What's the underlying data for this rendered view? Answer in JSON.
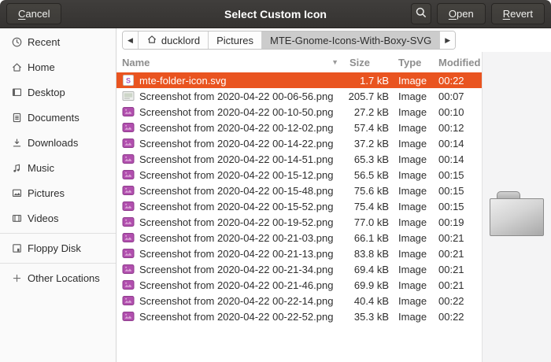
{
  "colors": {
    "accent": "#E95420",
    "headerbar": "#3b3937",
    "sidebar_bg": "#fafafa",
    "preview_bg": "#f4f4f5",
    "thumb_magenta": "#b14fae"
  },
  "header": {
    "title": "Select Custom Icon",
    "cancel_label": "Cancel",
    "open_label": "Open",
    "revert_label": "Revert",
    "search_icon": "search-icon"
  },
  "pathbar": {
    "back_glyph": "◀",
    "forward_glyph": "▶",
    "crumbs": [
      {
        "label": "ducklord",
        "icon": "home-icon",
        "active": false
      },
      {
        "label": "Pictures",
        "active": false
      },
      {
        "label": "MTE-Gnome-Icons-With-Boxy-SVG",
        "active": true
      }
    ]
  },
  "sidebar": {
    "items": [
      {
        "label": "Recent",
        "icon": "clock-icon",
        "separator_before": false
      },
      {
        "label": "Home",
        "icon": "home-icon",
        "separator_before": false
      },
      {
        "label": "Desktop",
        "icon": "desktop-icon",
        "separator_before": false
      },
      {
        "label": "Documents",
        "icon": "document-icon",
        "separator_before": false
      },
      {
        "label": "Downloads",
        "icon": "download-icon",
        "separator_before": false
      },
      {
        "label": "Music",
        "icon": "music-note-icon",
        "separator_before": false
      },
      {
        "label": "Pictures",
        "icon": "picture-icon",
        "separator_before": false
      },
      {
        "label": "Videos",
        "icon": "film-icon",
        "separator_before": false
      },
      {
        "label": "Floppy Disk",
        "icon": "floppy-icon",
        "separator_before": true
      },
      {
        "label": "Other Locations",
        "icon": "plus-icon",
        "separator_before": true
      }
    ]
  },
  "list": {
    "columns": [
      {
        "label": "Name"
      },
      {
        "label": "Size"
      },
      {
        "label": "Type"
      },
      {
        "label": "Modified"
      }
    ],
    "sort_indicator": "▼",
    "rows": [
      {
        "icon": "svg-file-icon",
        "name": "mte-folder-icon.svg",
        "size": "1.7 kB",
        "type": "Image",
        "modified": "00:22",
        "selected": true
      },
      {
        "icon": "image-thumb-gray-icon",
        "name": "Screenshot from 2020-04-22 00-06-56.png",
        "size": "205.7 kB",
        "type": "Image",
        "modified": "00:07",
        "selected": false
      },
      {
        "icon": "image-thumb-magenta-icon",
        "name": "Screenshot from 2020-04-22 00-10-50.png",
        "size": "27.2 kB",
        "type": "Image",
        "modified": "00:10",
        "selected": false
      },
      {
        "icon": "image-thumb-magenta-icon",
        "name": "Screenshot from 2020-04-22 00-12-02.png",
        "size": "57.4 kB",
        "type": "Image",
        "modified": "00:12",
        "selected": false
      },
      {
        "icon": "image-thumb-magenta-icon",
        "name": "Screenshot from 2020-04-22 00-14-22.png",
        "size": "37.2 kB",
        "type": "Image",
        "modified": "00:14",
        "selected": false
      },
      {
        "icon": "image-thumb-magenta-icon",
        "name": "Screenshot from 2020-04-22 00-14-51.png",
        "size": "65.3 kB",
        "type": "Image",
        "modified": "00:14",
        "selected": false
      },
      {
        "icon": "image-thumb-magenta-icon",
        "name": "Screenshot from 2020-04-22 00-15-12.png",
        "size": "56.5 kB",
        "type": "Image",
        "modified": "00:15",
        "selected": false
      },
      {
        "icon": "image-thumb-magenta-icon",
        "name": "Screenshot from 2020-04-22 00-15-48.png",
        "size": "75.6 kB",
        "type": "Image",
        "modified": "00:15",
        "selected": false
      },
      {
        "icon": "image-thumb-magenta-icon",
        "name": "Screenshot from 2020-04-22 00-15-52.png",
        "size": "75.4 kB",
        "type": "Image",
        "modified": "00:15",
        "selected": false
      },
      {
        "icon": "image-thumb-magenta-icon",
        "name": "Screenshot from 2020-04-22 00-19-52.png",
        "size": "77.0 kB",
        "type": "Image",
        "modified": "00:19",
        "selected": false
      },
      {
        "icon": "image-thumb-magenta-icon",
        "name": "Screenshot from 2020-04-22 00-21-03.png",
        "size": "66.1 kB",
        "type": "Image",
        "modified": "00:21",
        "selected": false
      },
      {
        "icon": "image-thumb-magenta-icon",
        "name": "Screenshot from 2020-04-22 00-21-13.png",
        "size": "83.8 kB",
        "type": "Image",
        "modified": "00:21",
        "selected": false
      },
      {
        "icon": "image-thumb-magenta-icon",
        "name": "Screenshot from 2020-04-22 00-21-34.png",
        "size": "69.4 kB",
        "type": "Image",
        "modified": "00:21",
        "selected": false
      },
      {
        "icon": "image-thumb-magenta-icon",
        "name": "Screenshot from 2020-04-22 00-21-46.png",
        "size": "69.9 kB",
        "type": "Image",
        "modified": "00:21",
        "selected": false
      },
      {
        "icon": "image-thumb-magenta-icon",
        "name": "Screenshot from 2020-04-22 00-22-14.png",
        "size": "40.4 kB",
        "type": "Image",
        "modified": "00:22",
        "selected": false
      },
      {
        "icon": "image-thumb-magenta-icon",
        "name": "Screenshot from 2020-04-22 00-22-52.png",
        "size": "35.3 kB",
        "type": "Image",
        "modified": "00:22",
        "selected": false
      }
    ]
  },
  "preview": {
    "icon": "folder-icon"
  }
}
